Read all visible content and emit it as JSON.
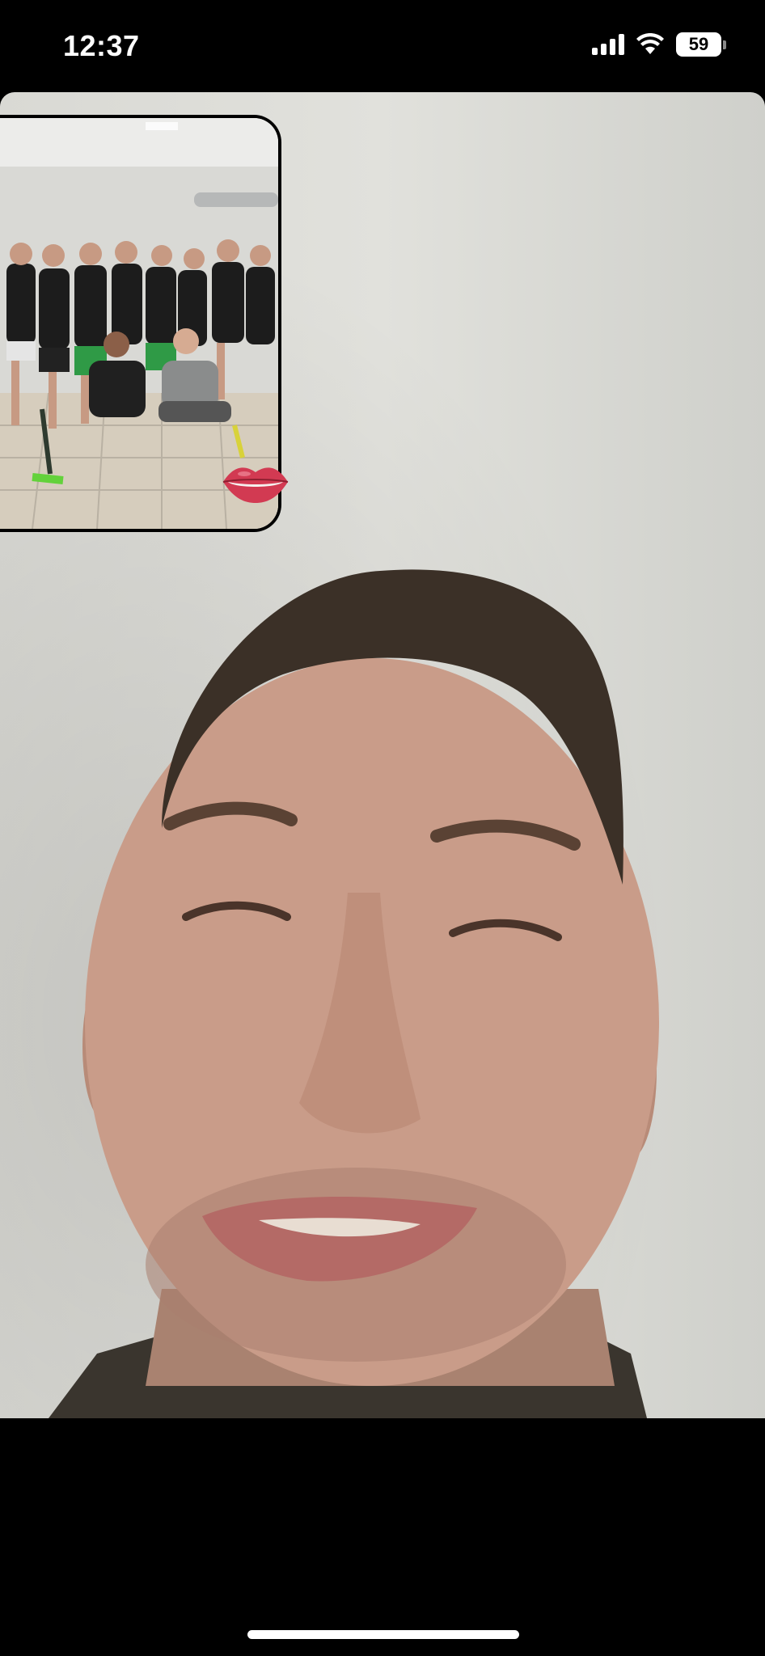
{
  "status_bar": {
    "time": "12:37",
    "battery_level": "59",
    "icons": [
      "cellular-signal-icon",
      "wifi-icon",
      "battery-icon"
    ]
  },
  "main_video": {
    "description_role": "remote-participant-video"
  },
  "pip_video": {
    "role": "self-view",
    "sticker": "kiss-lips-sticker"
  },
  "colors": {
    "background": "#000000",
    "wall": "#dcdcd7",
    "skin": "#c89a88",
    "jersey": "#1c1c1c",
    "shorts_green": "#2f9a46"
  }
}
